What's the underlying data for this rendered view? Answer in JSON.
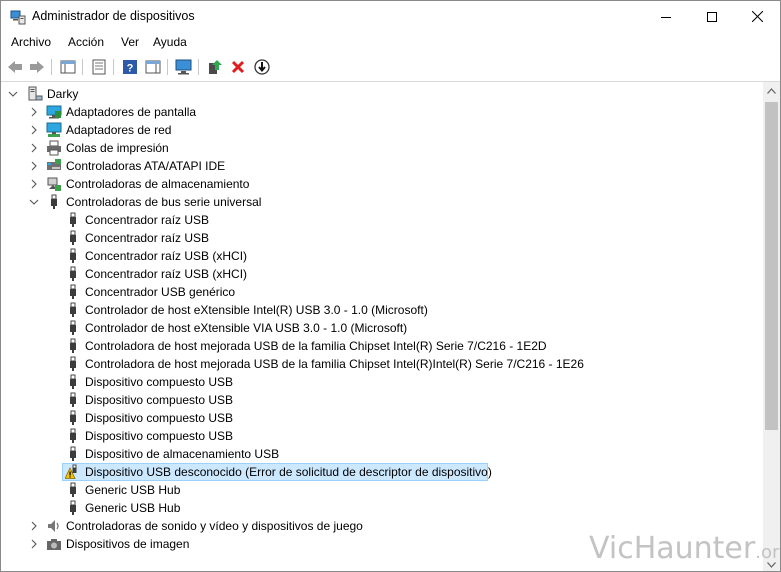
{
  "window": {
    "title": "Administrador de dispositivos"
  },
  "menu": [
    "Archivo",
    "Acción",
    "Ver",
    "Ayuda"
  ],
  "tree": {
    "root": "Darky",
    "categories": [
      "Adaptadores de pantalla",
      "Adaptadores de red",
      "Colas de impresión",
      "Controladoras ATA/ATAPI IDE",
      "Controladoras de almacenamiento",
      "Controladoras de bus serie universal"
    ],
    "usb_devices": [
      "Concentrador raíz USB",
      "Concentrador raíz USB",
      "Concentrador raíz USB (xHCI)",
      "Concentrador raíz USB (xHCI)",
      "Concentrador USB genérico",
      "Controlador de host eXtensible Intel(R) USB 3.0 - 1.0 (Microsoft)",
      "Controlador de host eXtensible VIA USB 3.0 - 1.0 (Microsoft)",
      "Controladora de host mejorada USB de la familia Chipset Intel(R) Serie 7/C216 - 1E2D",
      "Controladora de host mejorada USB de la familia Chipset Intel(R)Intel(R) Serie 7/C216 - 1E26",
      "Dispositivo compuesto USB",
      "Dispositivo compuesto USB",
      "Dispositivo compuesto USB",
      "Dispositivo compuesto USB",
      "Dispositivo de almacenamiento USB",
      "Dispositivo USB desconocido (Error de solicitud de descriptor de dispositivo)",
      "Generic USB Hub",
      "Generic USB Hub"
    ],
    "categories_after": [
      "Controladoras de sonido y vídeo y dispositivos de juego",
      "Dispositivos de imagen"
    ]
  },
  "watermark": {
    "main": "VicHaunter",
    "suffix": ".org"
  },
  "colors": {
    "selection": "#cce8ff",
    "warning": "#f5c400",
    "accent": "#0078d7"
  }
}
